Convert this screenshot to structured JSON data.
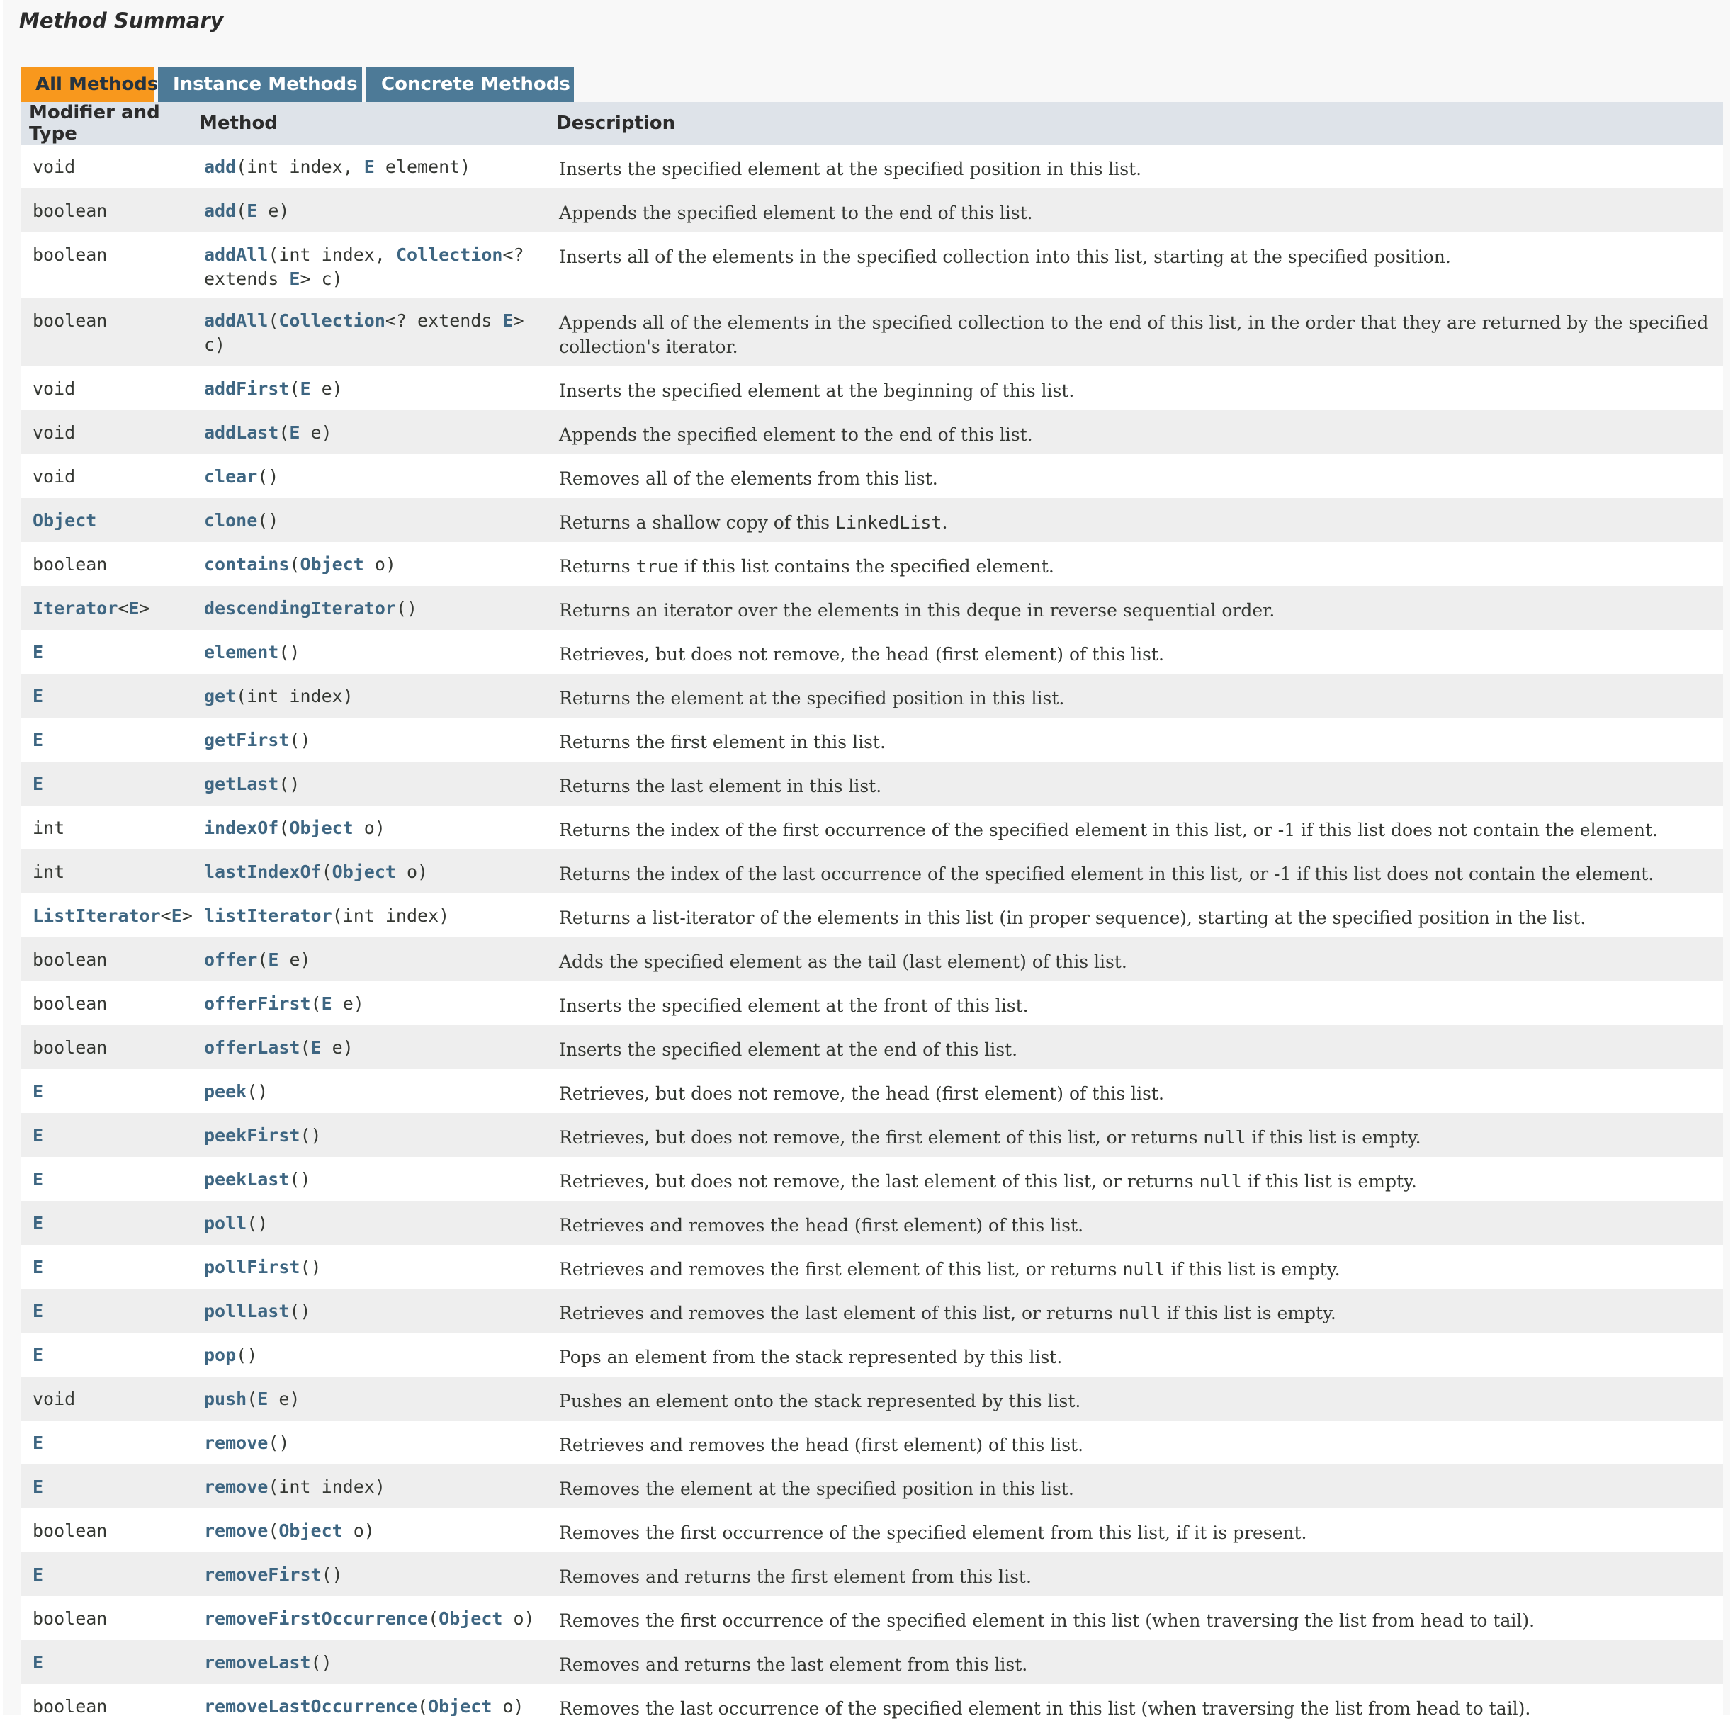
{
  "title": "Method Summary",
  "tabs": [
    {
      "label": "All Methods",
      "active": true
    },
    {
      "label": "Instance Methods",
      "active": false
    },
    {
      "label": "Concrete Methods",
      "active": false
    }
  ],
  "columns": [
    "Modifier and Type",
    "Method",
    "Description"
  ],
  "colors": {
    "active_tab": "#f8981d",
    "tab": "#4d7a97",
    "header": "#dee3e9",
    "link": "#3e6682",
    "alt_row": "#eeeeee"
  },
  "methods": [
    {
      "type": [
        [
          "void",
          0
        ]
      ],
      "sig": [
        [
          "add",
          1
        ],
        [
          "(int index, ",
          0
        ],
        [
          "E",
          1
        ],
        [
          " element)",
          0
        ]
      ],
      "desc": [
        [
          "Inserts the specified element at the specified position in this list.",
          0
        ]
      ]
    },
    {
      "type": [
        [
          "boolean",
          0
        ]
      ],
      "sig": [
        [
          "add",
          1
        ],
        [
          "(",
          0
        ],
        [
          "E",
          1
        ],
        [
          " e)",
          0
        ]
      ],
      "desc": [
        [
          "Appends the specified element to the end of this list.",
          0
        ]
      ]
    },
    {
      "type": [
        [
          "boolean",
          0
        ]
      ],
      "sig": [
        [
          "addAll",
          1
        ],
        [
          "(int index, ",
          0
        ],
        [
          "Collection",
          1
        ],
        [
          "<? extends ",
          0
        ],
        [
          "E",
          1
        ],
        [
          "> c)",
          0
        ]
      ],
      "desc": [
        [
          "Inserts all of the elements in the specified collection into this list, starting at the specified position.",
          0
        ]
      ],
      "tall": true
    },
    {
      "type": [
        [
          "boolean",
          0
        ]
      ],
      "sig": [
        [
          "addAll",
          1
        ],
        [
          "(",
          0
        ],
        [
          "Collection",
          1
        ],
        [
          "<? extends ",
          0
        ],
        [
          "E",
          1
        ],
        [
          "> c)",
          0
        ]
      ],
      "desc": [
        [
          "Appends all of the elements in the specified collection to the end of this list, in the order that they are returned by the specified collection's iterator.",
          0
        ]
      ],
      "tall": true
    },
    {
      "type": [
        [
          "void",
          0
        ]
      ],
      "sig": [
        [
          "addFirst",
          1
        ],
        [
          "(",
          0
        ],
        [
          "E",
          1
        ],
        [
          " e)",
          0
        ]
      ],
      "desc": [
        [
          "Inserts the specified element at the beginning of this list.",
          0
        ]
      ]
    },
    {
      "type": [
        [
          "void",
          0
        ]
      ],
      "sig": [
        [
          "addLast",
          1
        ],
        [
          "(",
          0
        ],
        [
          "E",
          1
        ],
        [
          " e)",
          0
        ]
      ],
      "desc": [
        [
          "Appends the specified element to the end of this list.",
          0
        ]
      ]
    },
    {
      "type": [
        [
          "void",
          0
        ]
      ],
      "sig": [
        [
          "clear",
          1
        ],
        [
          "()",
          0
        ]
      ],
      "desc": [
        [
          "Removes all of the elements from this list.",
          0
        ]
      ]
    },
    {
      "type": [
        [
          "Object",
          1
        ]
      ],
      "sig": [
        [
          "clone",
          1
        ],
        [
          "()",
          0
        ]
      ],
      "desc": [
        [
          "Returns a shallow copy of this ",
          0
        ],
        [
          "LinkedList",
          2
        ],
        [
          ".",
          0
        ]
      ]
    },
    {
      "type": [
        [
          "boolean",
          0
        ]
      ],
      "sig": [
        [
          "contains",
          1
        ],
        [
          "(",
          0
        ],
        [
          "Object",
          1
        ],
        [
          " o)",
          0
        ]
      ],
      "desc": [
        [
          "Returns ",
          0
        ],
        [
          "true",
          2
        ],
        [
          " if this list contains the specified element.",
          0
        ]
      ]
    },
    {
      "type": [
        [
          "Iterator",
          1
        ],
        [
          "<",
          0
        ],
        [
          "E",
          1
        ],
        [
          ">",
          0
        ]
      ],
      "sig": [
        [
          "descendingIterator",
          1
        ],
        [
          "()",
          0
        ]
      ],
      "desc": [
        [
          "Returns an iterator over the elements in this deque in reverse sequential order.",
          0
        ]
      ]
    },
    {
      "type": [
        [
          "E",
          1
        ]
      ],
      "sig": [
        [
          "element",
          1
        ],
        [
          "()",
          0
        ]
      ],
      "desc": [
        [
          "Retrieves, but does not remove, the head (first element) of this list.",
          0
        ]
      ]
    },
    {
      "type": [
        [
          "E",
          1
        ]
      ],
      "sig": [
        [
          "get",
          1
        ],
        [
          "(int index)",
          0
        ]
      ],
      "desc": [
        [
          "Returns the element at the specified position in this list.",
          0
        ]
      ]
    },
    {
      "type": [
        [
          "E",
          1
        ]
      ],
      "sig": [
        [
          "getFirst",
          1
        ],
        [
          "()",
          0
        ]
      ],
      "desc": [
        [
          "Returns the first element in this list.",
          0
        ]
      ]
    },
    {
      "type": [
        [
          "E",
          1
        ]
      ],
      "sig": [
        [
          "getLast",
          1
        ],
        [
          "()",
          0
        ]
      ],
      "desc": [
        [
          "Returns the last element in this list.",
          0
        ]
      ]
    },
    {
      "type": [
        [
          "int",
          0
        ]
      ],
      "sig": [
        [
          "indexOf",
          1
        ],
        [
          "(",
          0
        ],
        [
          "Object",
          1
        ],
        [
          " o)",
          0
        ]
      ],
      "desc": [
        [
          "Returns the index of the first occurrence of the specified element in this list, or -1 if this list does not contain the element.",
          0
        ]
      ]
    },
    {
      "type": [
        [
          "int",
          0
        ]
      ],
      "sig": [
        [
          "lastIndexOf",
          1
        ],
        [
          "(",
          0
        ],
        [
          "Object",
          1
        ],
        [
          " o)",
          0
        ]
      ],
      "desc": [
        [
          "Returns the index of the last occurrence of the specified element in this list, or -1 if this list does not contain the element.",
          0
        ]
      ]
    },
    {
      "type": [
        [
          "ListIterator",
          1
        ],
        [
          "<",
          0
        ],
        [
          "E",
          1
        ],
        [
          ">",
          0
        ]
      ],
      "sig": [
        [
          "listIterator",
          1
        ],
        [
          "(int index)",
          0
        ]
      ],
      "desc": [
        [
          "Returns a list-iterator of the elements in this list (in proper sequence), starting at the specified position in the list.",
          0
        ]
      ]
    },
    {
      "type": [
        [
          "boolean",
          0
        ]
      ],
      "sig": [
        [
          "offer",
          1
        ],
        [
          "(",
          0
        ],
        [
          "E",
          1
        ],
        [
          " e)",
          0
        ]
      ],
      "desc": [
        [
          "Adds the specified element as the tail (last element) of this list.",
          0
        ]
      ]
    },
    {
      "type": [
        [
          "boolean",
          0
        ]
      ],
      "sig": [
        [
          "offerFirst",
          1
        ],
        [
          "(",
          0
        ],
        [
          "E",
          1
        ],
        [
          " e)",
          0
        ]
      ],
      "desc": [
        [
          "Inserts the specified element at the front of this list.",
          0
        ]
      ]
    },
    {
      "type": [
        [
          "boolean",
          0
        ]
      ],
      "sig": [
        [
          "offerLast",
          1
        ],
        [
          "(",
          0
        ],
        [
          "E",
          1
        ],
        [
          " e)",
          0
        ]
      ],
      "desc": [
        [
          "Inserts the specified element at the end of this list.",
          0
        ]
      ]
    },
    {
      "type": [
        [
          "E",
          1
        ]
      ],
      "sig": [
        [
          "peek",
          1
        ],
        [
          "()",
          0
        ]
      ],
      "desc": [
        [
          "Retrieves, but does not remove, the head (first element) of this list.",
          0
        ]
      ]
    },
    {
      "type": [
        [
          "E",
          1
        ]
      ],
      "sig": [
        [
          "peekFirst",
          1
        ],
        [
          "()",
          0
        ]
      ],
      "desc": [
        [
          "Retrieves, but does not remove, the first element of this list, or returns ",
          0
        ],
        [
          "null",
          2
        ],
        [
          " if this list is empty.",
          0
        ]
      ]
    },
    {
      "type": [
        [
          "E",
          1
        ]
      ],
      "sig": [
        [
          "peekLast",
          1
        ],
        [
          "()",
          0
        ]
      ],
      "desc": [
        [
          "Retrieves, but does not remove, the last element of this list, or returns ",
          0
        ],
        [
          "null",
          2
        ],
        [
          " if this list is empty.",
          0
        ]
      ]
    },
    {
      "type": [
        [
          "E",
          1
        ]
      ],
      "sig": [
        [
          "poll",
          1
        ],
        [
          "()",
          0
        ]
      ],
      "desc": [
        [
          "Retrieves and removes the head (first element) of this list.",
          0
        ]
      ]
    },
    {
      "type": [
        [
          "E",
          1
        ]
      ],
      "sig": [
        [
          "pollFirst",
          1
        ],
        [
          "()",
          0
        ]
      ],
      "desc": [
        [
          "Retrieves and removes the first element of this list, or returns ",
          0
        ],
        [
          "null",
          2
        ],
        [
          " if this list is empty.",
          0
        ]
      ]
    },
    {
      "type": [
        [
          "E",
          1
        ]
      ],
      "sig": [
        [
          "pollLast",
          1
        ],
        [
          "()",
          0
        ]
      ],
      "desc": [
        [
          "Retrieves and removes the last element of this list, or returns ",
          0
        ],
        [
          "null",
          2
        ],
        [
          " if this list is empty.",
          0
        ]
      ]
    },
    {
      "type": [
        [
          "E",
          1
        ]
      ],
      "sig": [
        [
          "pop",
          1
        ],
        [
          "()",
          0
        ]
      ],
      "desc": [
        [
          "Pops an element from the stack represented by this list.",
          0
        ]
      ]
    },
    {
      "type": [
        [
          "void",
          0
        ]
      ],
      "sig": [
        [
          "push",
          1
        ],
        [
          "(",
          0
        ],
        [
          "E",
          1
        ],
        [
          " e)",
          0
        ]
      ],
      "desc": [
        [
          "Pushes an element onto the stack represented by this list.",
          0
        ]
      ]
    },
    {
      "type": [
        [
          "E",
          1
        ]
      ],
      "sig": [
        [
          "remove",
          1
        ],
        [
          "()",
          0
        ]
      ],
      "desc": [
        [
          "Retrieves and removes the head (first element) of this list.",
          0
        ]
      ]
    },
    {
      "type": [
        [
          "E",
          1
        ]
      ],
      "sig": [
        [
          "remove",
          1
        ],
        [
          "(int index)",
          0
        ]
      ],
      "desc": [
        [
          "Removes the element at the specified position in this list.",
          0
        ]
      ]
    },
    {
      "type": [
        [
          "boolean",
          0
        ]
      ],
      "sig": [
        [
          "remove",
          1
        ],
        [
          "(",
          0
        ],
        [
          "Object",
          1
        ],
        [
          " o)",
          0
        ]
      ],
      "desc": [
        [
          "Removes the first occurrence of the specified element from this list, if it is present.",
          0
        ]
      ]
    },
    {
      "type": [
        [
          "E",
          1
        ]
      ],
      "sig": [
        [
          "removeFirst",
          1
        ],
        [
          "()",
          0
        ]
      ],
      "desc": [
        [
          "Removes and returns the first element from this list.",
          0
        ]
      ]
    },
    {
      "type": [
        [
          "boolean",
          0
        ]
      ],
      "sig": [
        [
          "removeFirstOccurrence",
          1
        ],
        [
          "(",
          0
        ],
        [
          "Object",
          1
        ],
        [
          " o)",
          0
        ]
      ],
      "desc": [
        [
          "Removes the first occurrence of the specified element in this list (when traversing the list from head to tail).",
          0
        ]
      ]
    },
    {
      "type": [
        [
          "E",
          1
        ]
      ],
      "sig": [
        [
          "removeLast",
          1
        ],
        [
          "()",
          0
        ]
      ],
      "desc": [
        [
          "Removes and returns the last element from this list.",
          0
        ]
      ]
    },
    {
      "type": [
        [
          "boolean",
          0
        ]
      ],
      "sig": [
        [
          "removeLastOccurrence",
          1
        ],
        [
          "(",
          0
        ],
        [
          "Object",
          1
        ],
        [
          " o)",
          0
        ]
      ],
      "desc": [
        [
          "Removes the last occurrence of the specified element in this list (when traversing the list from head to tail).",
          0
        ]
      ]
    }
  ]
}
